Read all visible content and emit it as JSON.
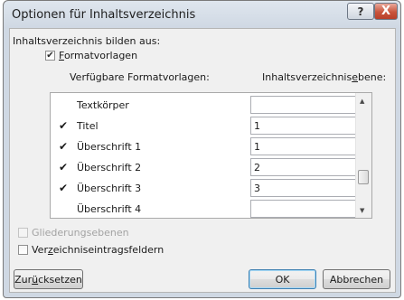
{
  "window": {
    "title": "Optionen für Inhaltsverzeichnis",
    "help_glyph": "?",
    "close_glyph": "X"
  },
  "build_from_label": "Inhaltsverzeichnis bilden aus:",
  "formatvorlagen": {
    "label": "Formatvorlagen",
    "checked": true
  },
  "columns": {
    "available_styles": "Verfügbare Formatvorlagen:",
    "toc_level": "Inhaltsverzeichnisebene:"
  },
  "styles": [
    {
      "name": "Textkörper",
      "checked": false,
      "level": ""
    },
    {
      "name": "Titel",
      "checked": true,
      "level": "1"
    },
    {
      "name": "Überschrift 1",
      "checked": true,
      "level": "1"
    },
    {
      "name": "Überschrift 2",
      "checked": true,
      "level": "2"
    },
    {
      "name": "Überschrift 3",
      "checked": true,
      "level": "3"
    },
    {
      "name": "Überschrift 4",
      "checked": false,
      "level": ""
    }
  ],
  "check_glyph": "✔",
  "outline_levels": {
    "label": "Gliederungsebenen",
    "checked": false,
    "enabled": false
  },
  "toc_entry_fields": {
    "label": "Verzeichniseintragsfeldern",
    "checked": false,
    "enabled": true
  },
  "buttons": {
    "reset": "Zurücksetzen",
    "ok": "OK",
    "cancel": "Abbrechen"
  },
  "scroll_up_glyph": "▲",
  "scroll_down_glyph": "▼"
}
